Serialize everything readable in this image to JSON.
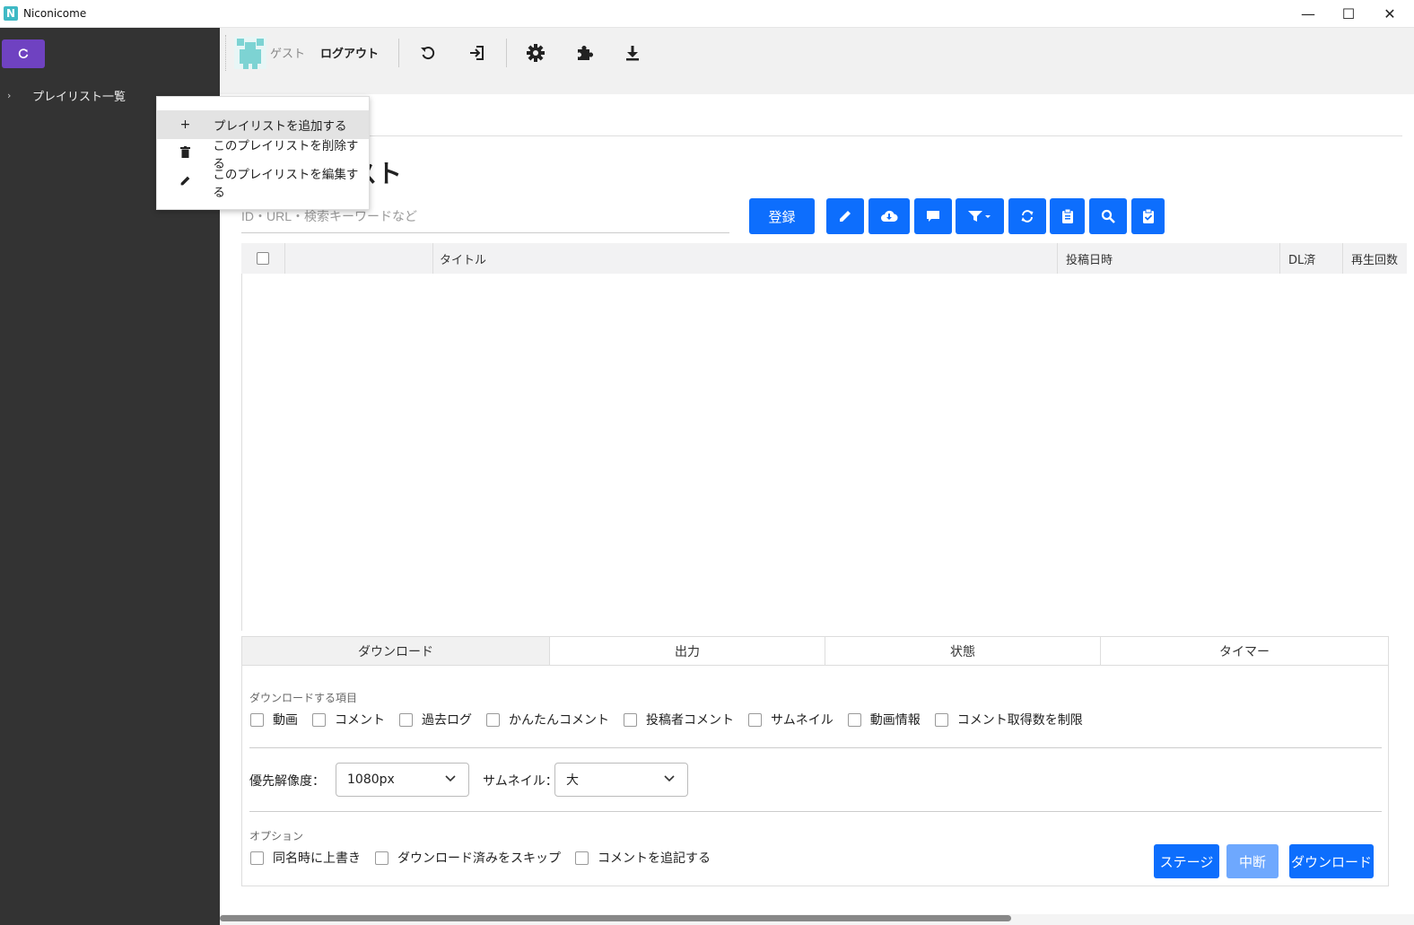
{
  "window": {
    "title": "Niconicome",
    "icon_letter": "N",
    "controls": {
      "minimize": "—",
      "maximize": "☐",
      "close": "✕"
    }
  },
  "sidebar": {
    "tree": [
      {
        "label": "プレイリスト一覧",
        "expanded": false
      }
    ]
  },
  "context_menu": {
    "items": [
      {
        "icon": "+",
        "label": "プレイリストを追加する"
      },
      {
        "icon": "trash-icon",
        "label": "このプレイリストを削除する"
      },
      {
        "icon": "pencil-icon",
        "label": "このプレイリストを編集する"
      }
    ]
  },
  "toolbar": {
    "user": "ゲスト",
    "logout": "ログアウト",
    "icons": [
      "rotate-left-icon",
      "login-icon",
      "gear-icon",
      "puzzle-icon",
      "download-icon"
    ]
  },
  "main": {
    "heading": "スト",
    "search": {
      "value": "",
      "placeholder": "ID・URL・検索キーワードなど"
    },
    "register_button": "登録",
    "icon_buttons": [
      "pencil-icon",
      "cloud-download-icon",
      "comment-icon",
      "filter-icon",
      "sync-icon",
      "clipboard-icon",
      "search-icon",
      "clipboard-check-icon"
    ],
    "table": {
      "columns": [
        "",
        "",
        "タイトル",
        "投稿日時",
        "DL済",
        "再生回数"
      ],
      "rows": []
    }
  },
  "panel": {
    "tabs": [
      "ダウンロード",
      "出力",
      "状態",
      "タイマー"
    ],
    "active_tab": "ダウンロード",
    "download_items_label": "ダウンロードする項目",
    "download_items": [
      "動画",
      "コメント",
      "過去ログ",
      "かんたんコメント",
      "投稿者コメント",
      "サムネイル",
      "動画情報",
      "コメント取得数を制限"
    ],
    "resolution_label": "優先解像度：",
    "resolution_value": "1080px",
    "thumbnail_label": "サムネイル：",
    "thumbnail_value": "大",
    "options_label": "オプション",
    "options": [
      "同名時に上書き",
      "ダウンロード済みをスキップ",
      "コメントを追記する"
    ],
    "buttons": {
      "stage": "ステージ",
      "abort": "中断",
      "download": "ダウンロード"
    }
  },
  "colors": {
    "sidebar_bg": "#333333",
    "accent_purple": "#6f42c1",
    "primary_blue": "#0d6efd",
    "disabled_blue": "#6ea8fe"
  }
}
